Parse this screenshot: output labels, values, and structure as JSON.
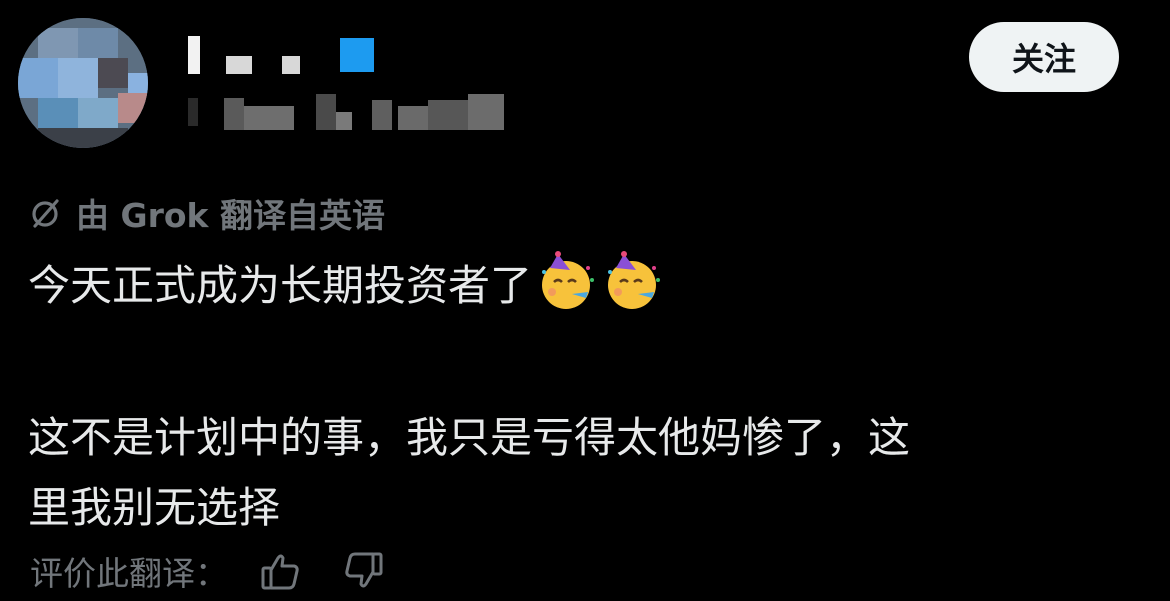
{
  "header": {
    "follow_label": "关注"
  },
  "translation_notice": {
    "text": "由 Grok 翻译自英语"
  },
  "post": {
    "line1": "今天正式成为长期投资者了",
    "emojis": [
      "partying-face",
      "partying-face"
    ],
    "line2": "这不是计划中的事，我只是亏得太他妈惨了，这",
    "line3": "里我别无选择"
  },
  "rating": {
    "prompt": "评价此翻译："
  },
  "colors": {
    "background": "#000000",
    "text": "#e7e9ea",
    "muted": "#71767b",
    "follow_bg": "#eff3f4"
  }
}
